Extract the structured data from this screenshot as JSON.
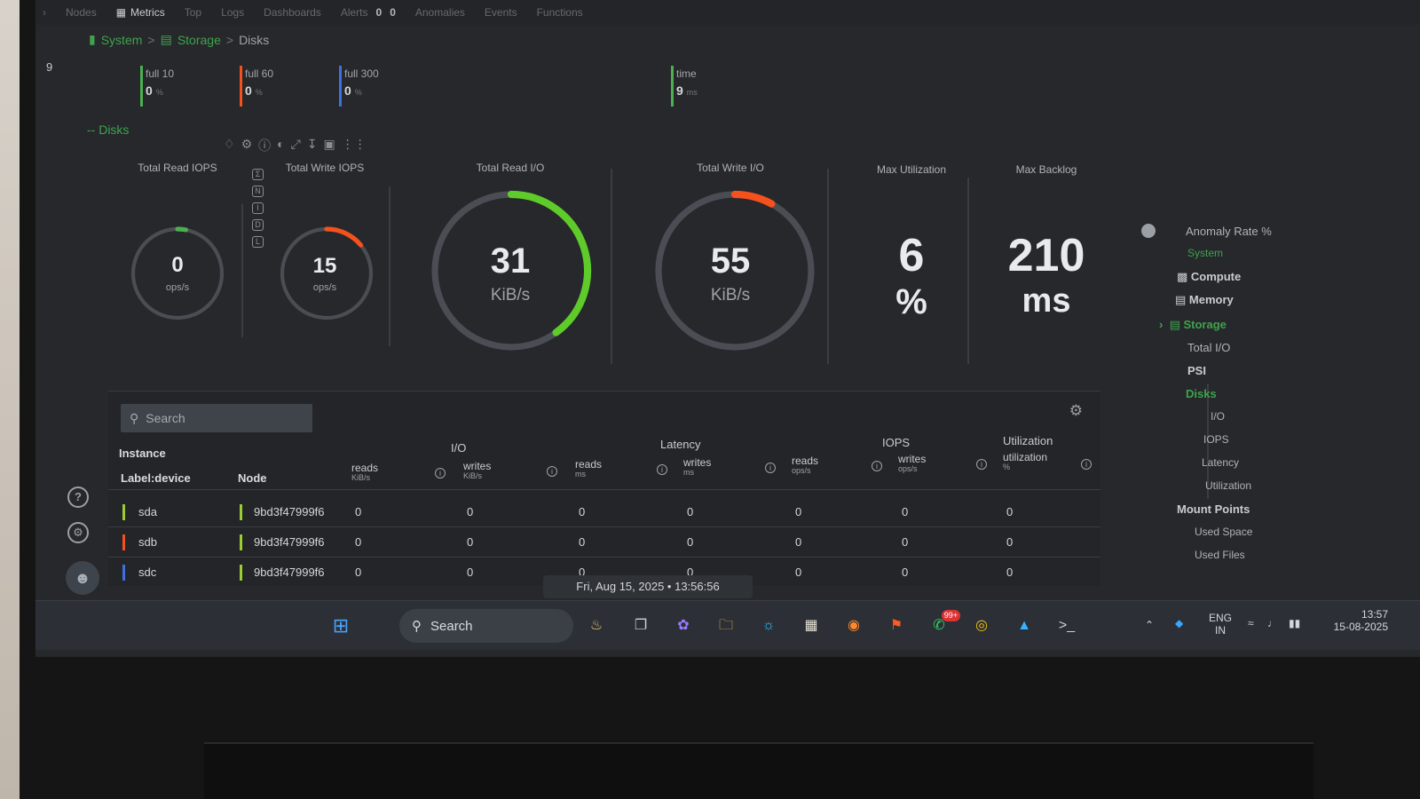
{
  "nav": {
    "items": [
      "Nodes",
      "Metrics",
      "Top",
      "Logs",
      "Dashboards",
      "Alerts",
      "Anomalies",
      "Events",
      "Functions"
    ],
    "alert_counts": [
      "0",
      "0"
    ]
  },
  "breadcrumb": {
    "system": "System",
    "storage": "Storage",
    "disks": "Disks",
    "sep": ">"
  },
  "left_num": "9",
  "alarms": [
    {
      "label": "full 10",
      "value": "0",
      "unit": "%",
      "color": "#4caf50"
    },
    {
      "label": "full 60",
      "value": "0",
      "unit": "%",
      "color": "#f4511e"
    },
    {
      "label": "full 300",
      "value": "0",
      "unit": "%",
      "color": "#3f6fe0"
    },
    {
      "label": "time",
      "value": "9",
      "unit": "ms",
      "color": "#4caf50"
    }
  ],
  "section_title": "-- Disks",
  "gauges": [
    {
      "title": "Total Read IOPS",
      "value": "0",
      "unit": "ops/s",
      "fraction": 0.0,
      "color": "#4caf50"
    },
    {
      "title": "Total Write IOPS",
      "value": "15",
      "unit": "ops/s",
      "fraction": 0.14,
      "color": "#f4511e"
    },
    {
      "title": "Total Read I/O",
      "value": "31",
      "unit": "KiB/s",
      "fraction": 0.4,
      "color": "#5ecb2a"
    },
    {
      "title": "Total Write I/O",
      "value": "55",
      "unit": "KiB/s",
      "fraction": 0.08,
      "color": "#f4511e"
    }
  ],
  "easy": [
    {
      "title": "Max Utilization",
      "value": "6",
      "unit": "%"
    },
    {
      "title": "Max Backlog",
      "value": "210",
      "unit": "ms"
    }
  ],
  "table": {
    "search_placeholder": "Search",
    "groups": {
      "instance": "Instance",
      "io": "I/O",
      "latency": "Latency",
      "iops": "IOPS",
      "utilization": "Utilization"
    },
    "cols": {
      "label_device": "Label:device",
      "node": "Node",
      "io_reads": "reads",
      "io_reads_u": "KiB/s",
      "io_writes": "writes",
      "io_writes_u": "KiB/s",
      "lat_reads": "reads",
      "lat_reads_u": "ms",
      "lat_writes": "writes",
      "lat_writes_u": "ms",
      "iops_reads": "reads",
      "iops_reads_u": "ops/s",
      "iops_writes": "writes",
      "iops_writes_u": "ops/s",
      "util": "utilization",
      "util_u": "%"
    },
    "rows": [
      {
        "device": "sda",
        "node": "9bd3f47999f6",
        "color": "#9acd32",
        "vals": [
          "0",
          "0",
          "0",
          "0",
          "0",
          "0",
          "0"
        ]
      },
      {
        "device": "sdb",
        "node": "9bd3f47999f6",
        "color": "#f4511e",
        "vals": [
          "0",
          "0",
          "0",
          "0",
          "0",
          "0",
          "0"
        ]
      },
      {
        "device": "sdc",
        "node": "9bd3f47999f6",
        "color": "#3f6fe0",
        "vals": [
          "0",
          "0",
          "0",
          "0",
          "0",
          "0",
          "0"
        ]
      }
    ]
  },
  "timestamp": "Fri, Aug 15, 2025 • 13:56:56",
  "sidebar": {
    "anomaly": "Anomaly Rate %",
    "system": "System",
    "compute": "Compute",
    "memory": "Memory",
    "storage": "Storage",
    "total_io": "Total I/O",
    "psi": "PSI",
    "disks": "Disks",
    "io": "I/O",
    "iops": "IOPS",
    "latency": "Latency",
    "utilization": "Utilization",
    "mount_points": "Mount Points",
    "used_space": "Used Space",
    "used_files": "Used Files"
  },
  "taskbar": {
    "search": "Search",
    "whatsapp_badge": "99+",
    "lang": "ENG",
    "region": "IN",
    "time": "13:57",
    "date": "15-08-2025"
  },
  "icons": [
    "bell-icon",
    "filter-icon",
    "info-icon",
    "spinner-icon",
    "expand-icon",
    "download-icon",
    "save-icon",
    "grip-icon",
    "help-icon",
    "settings-icon",
    "user-icon",
    "search-icon",
    "windows-icon"
  ]
}
